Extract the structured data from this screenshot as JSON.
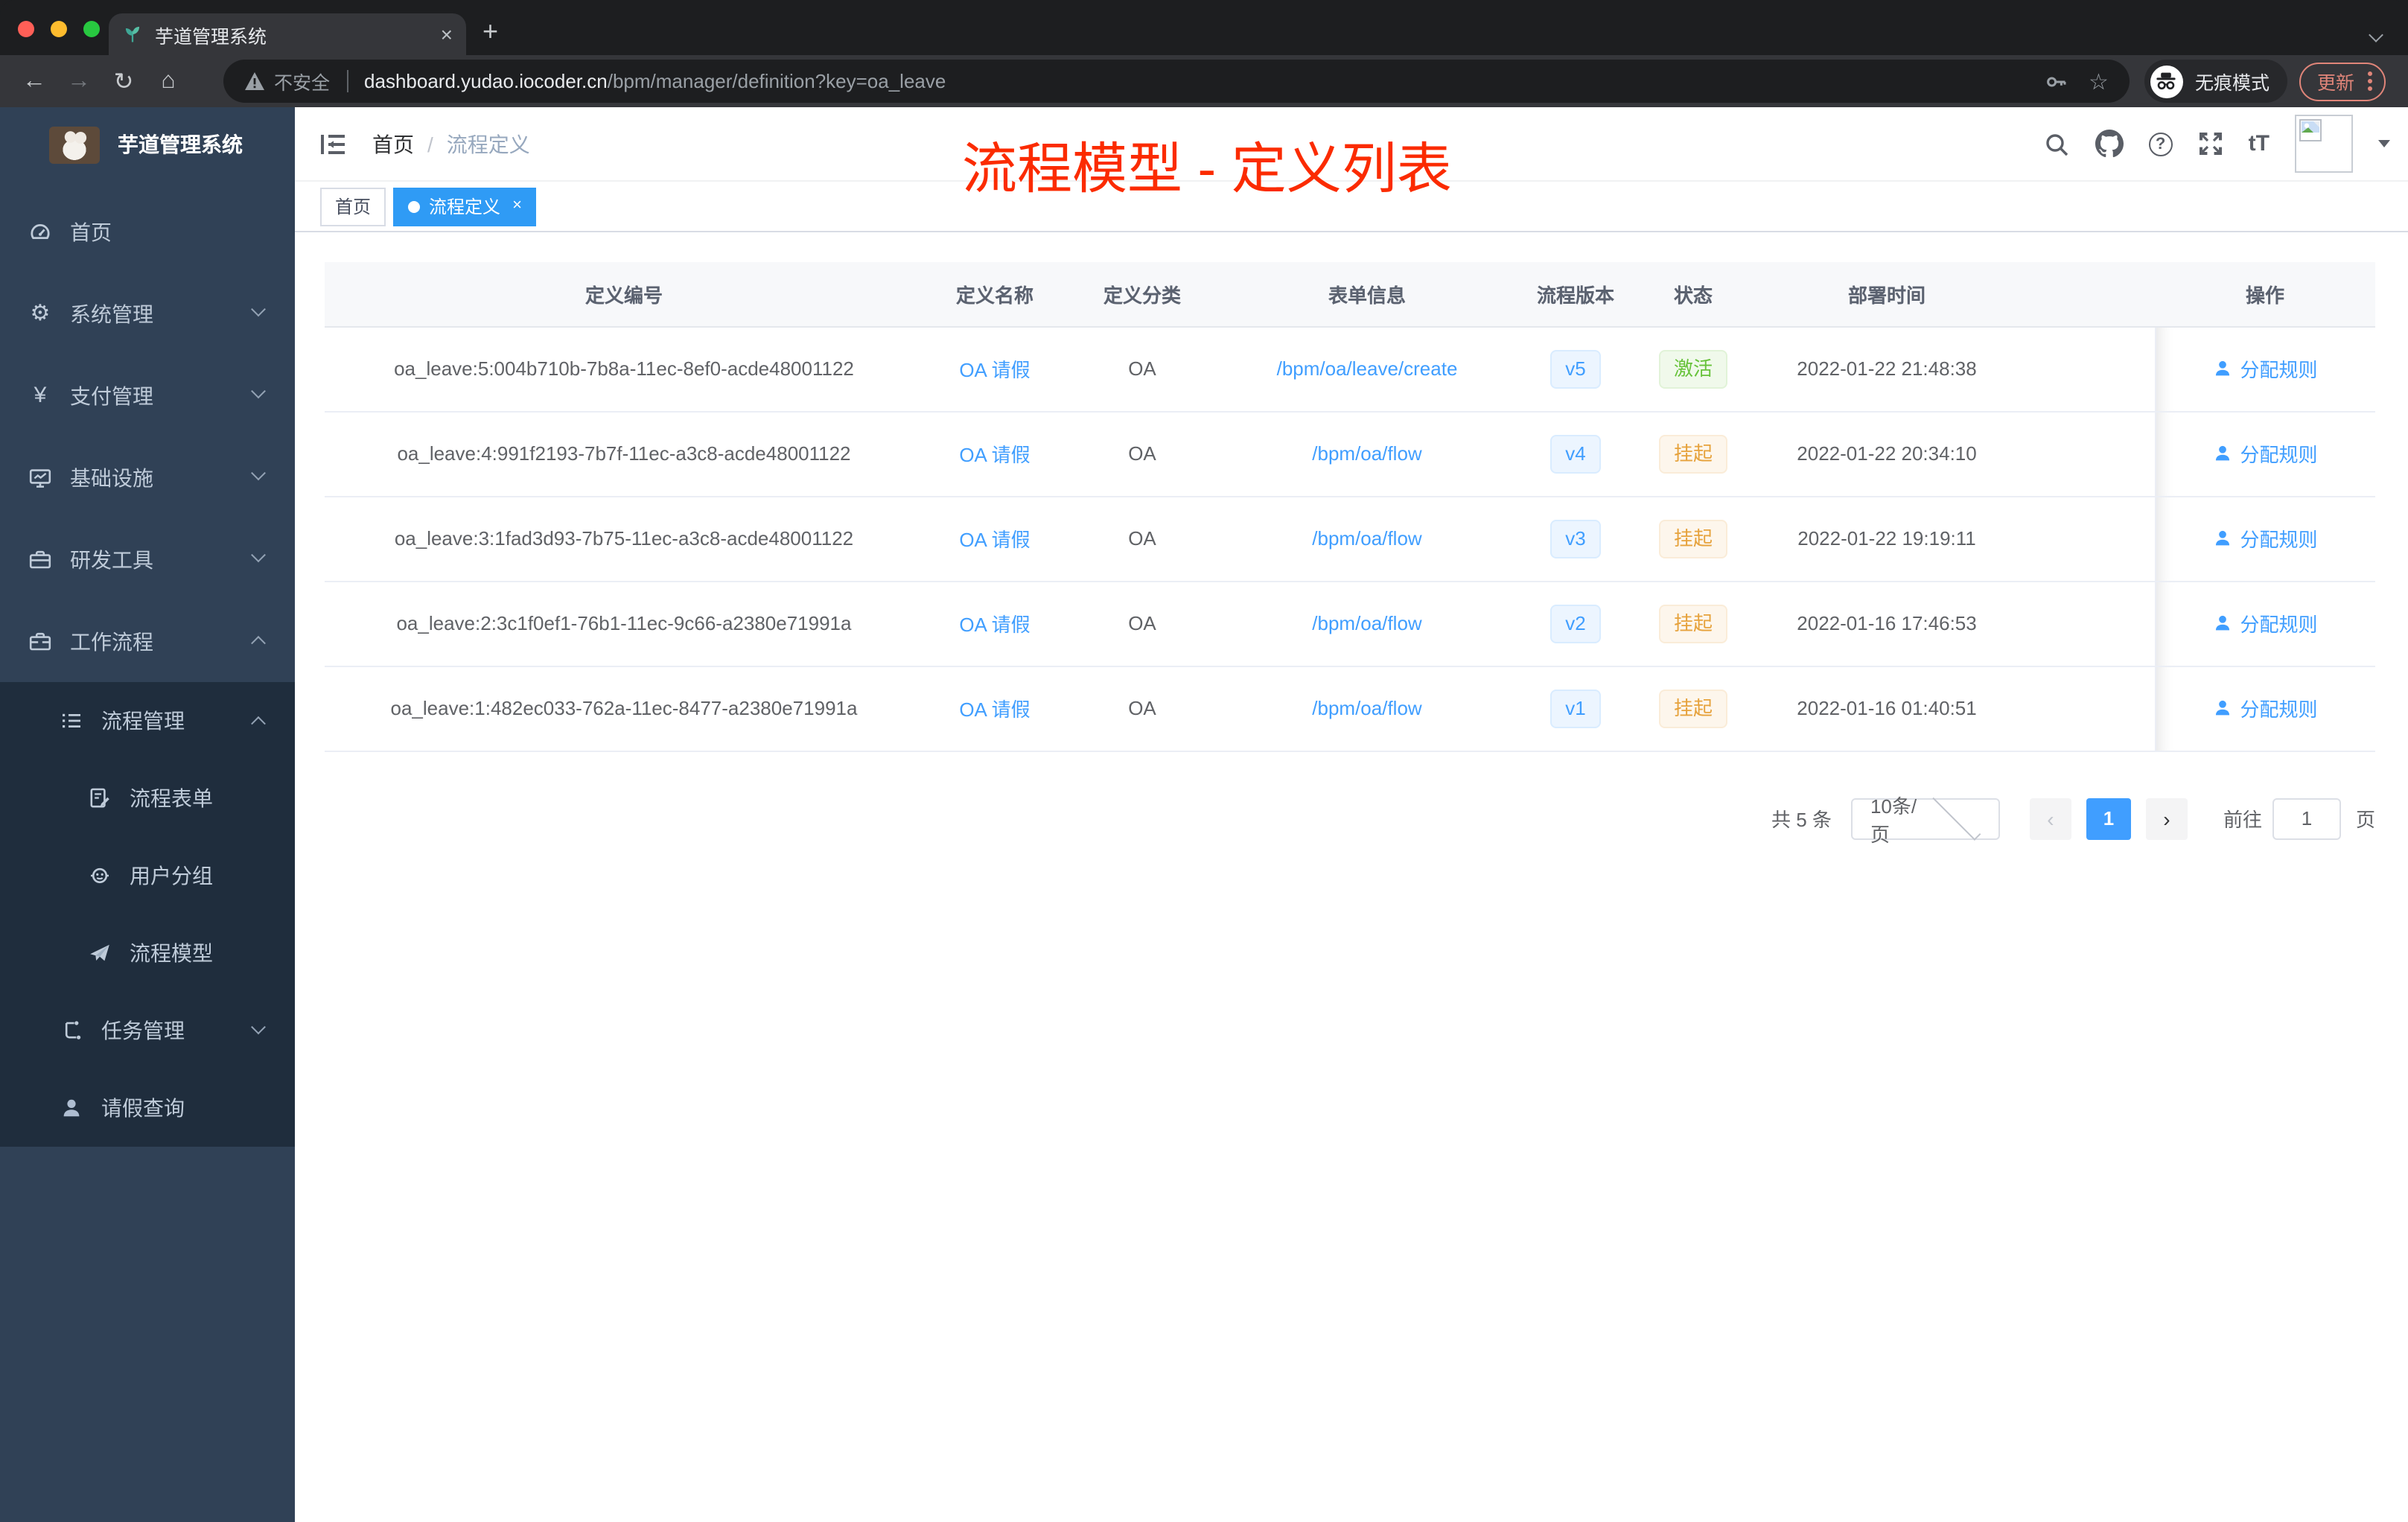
{
  "browser": {
    "tab_title": "芋道管理系统",
    "security_label": "不安全",
    "url_domain": "dashboard.yudao.iocoder.cn",
    "url_path": "/bpm/manager/definition?key=oa_leave",
    "incognito_label": "无痕模式",
    "update_label": "更新"
  },
  "icons": {
    "close_tab": "×",
    "new_tab": "+",
    "back": "←",
    "forward": "→",
    "reload": "↻",
    "home": "⌂",
    "star": "☆",
    "gear": "⚙",
    "yen": "¥",
    "question": "?",
    "font_size": "tT"
  },
  "sidebar": {
    "logo_title": "芋道管理系统",
    "menu": [
      {
        "label": "首页"
      },
      {
        "label": "系统管理"
      },
      {
        "label": "支付管理"
      },
      {
        "label": "基础设施"
      },
      {
        "label": "研发工具"
      },
      {
        "label": "工作流程"
      },
      {
        "label": "流程管理"
      },
      {
        "label": "流程表单"
      },
      {
        "label": "用户分组"
      },
      {
        "label": "流程模型"
      },
      {
        "label": "任务管理"
      },
      {
        "label": "请假查询"
      }
    ]
  },
  "header": {
    "breadcrumb_home": "首页",
    "breadcrumb_separator": "/",
    "breadcrumb_current": "流程定义",
    "annotation": "流程模型 - 定义列表",
    "annotation_color": "#fb2b00"
  },
  "tags": {
    "home": "首页",
    "active": "流程定义"
  },
  "table": {
    "headers": [
      "定义编号",
      "定义名称",
      "定义分类",
      "表单信息",
      "流程版本",
      "状态",
      "部署时间",
      "操作"
    ],
    "rows": [
      {
        "id": "oa_leave:5:004b710b-7b8a-11ec-8ef0-acde48001122",
        "name": "OA 请假",
        "category": "OA",
        "form": "/bpm/oa/leave/create",
        "version": "v5",
        "status": "激活",
        "deploy_time": "2022-01-22 21:48:38",
        "action": "分配规则"
      },
      {
        "id": "oa_leave:4:991f2193-7b7f-11ec-a3c8-acde48001122",
        "name": "OA 请假",
        "category": "OA",
        "form": "/bpm/oa/flow",
        "version": "v4",
        "status": "挂起",
        "deploy_time": "2022-01-22 20:34:10",
        "action": "分配规则"
      },
      {
        "id": "oa_leave:3:1fad3d93-7b75-11ec-a3c8-acde48001122",
        "name": "OA 请假",
        "category": "OA",
        "form": "/bpm/oa/flow",
        "version": "v3",
        "status": "挂起",
        "deploy_time": "2022-01-22 19:19:11",
        "action": "分配规则"
      },
      {
        "id": "oa_leave:2:3c1f0ef1-76b1-11ec-9c66-a2380e71991a",
        "name": "OA 请假",
        "category": "OA",
        "form": "/bpm/oa/flow",
        "version": "v2",
        "status": "挂起",
        "deploy_time": "2022-01-16 17:46:53",
        "action": "分配规则"
      },
      {
        "id": "oa_leave:1:482ec033-762a-11ec-8477-a2380e71991a",
        "name": "OA 请假",
        "category": "OA",
        "form": "/bpm/oa/flow",
        "version": "v1",
        "status": "挂起",
        "deploy_time": "2022-01-16 01:40:51",
        "action": "分配规则"
      }
    ]
  },
  "pagination": {
    "total": "共 5 条",
    "page_size": "10条/页",
    "prev": "‹",
    "current_page": "1",
    "next": "›",
    "goto": "前往",
    "goto_value": "1",
    "unit": "页"
  },
  "colors": {
    "primary": "#409eff",
    "sidebar_bg": "#304156",
    "submenu_bg": "#1f2d3d",
    "tag_active_bg": "#2f9bf5",
    "status_active": "#67c23a",
    "status_suspended": "#e6a23c",
    "annotation_red": "#fb2b00"
  }
}
